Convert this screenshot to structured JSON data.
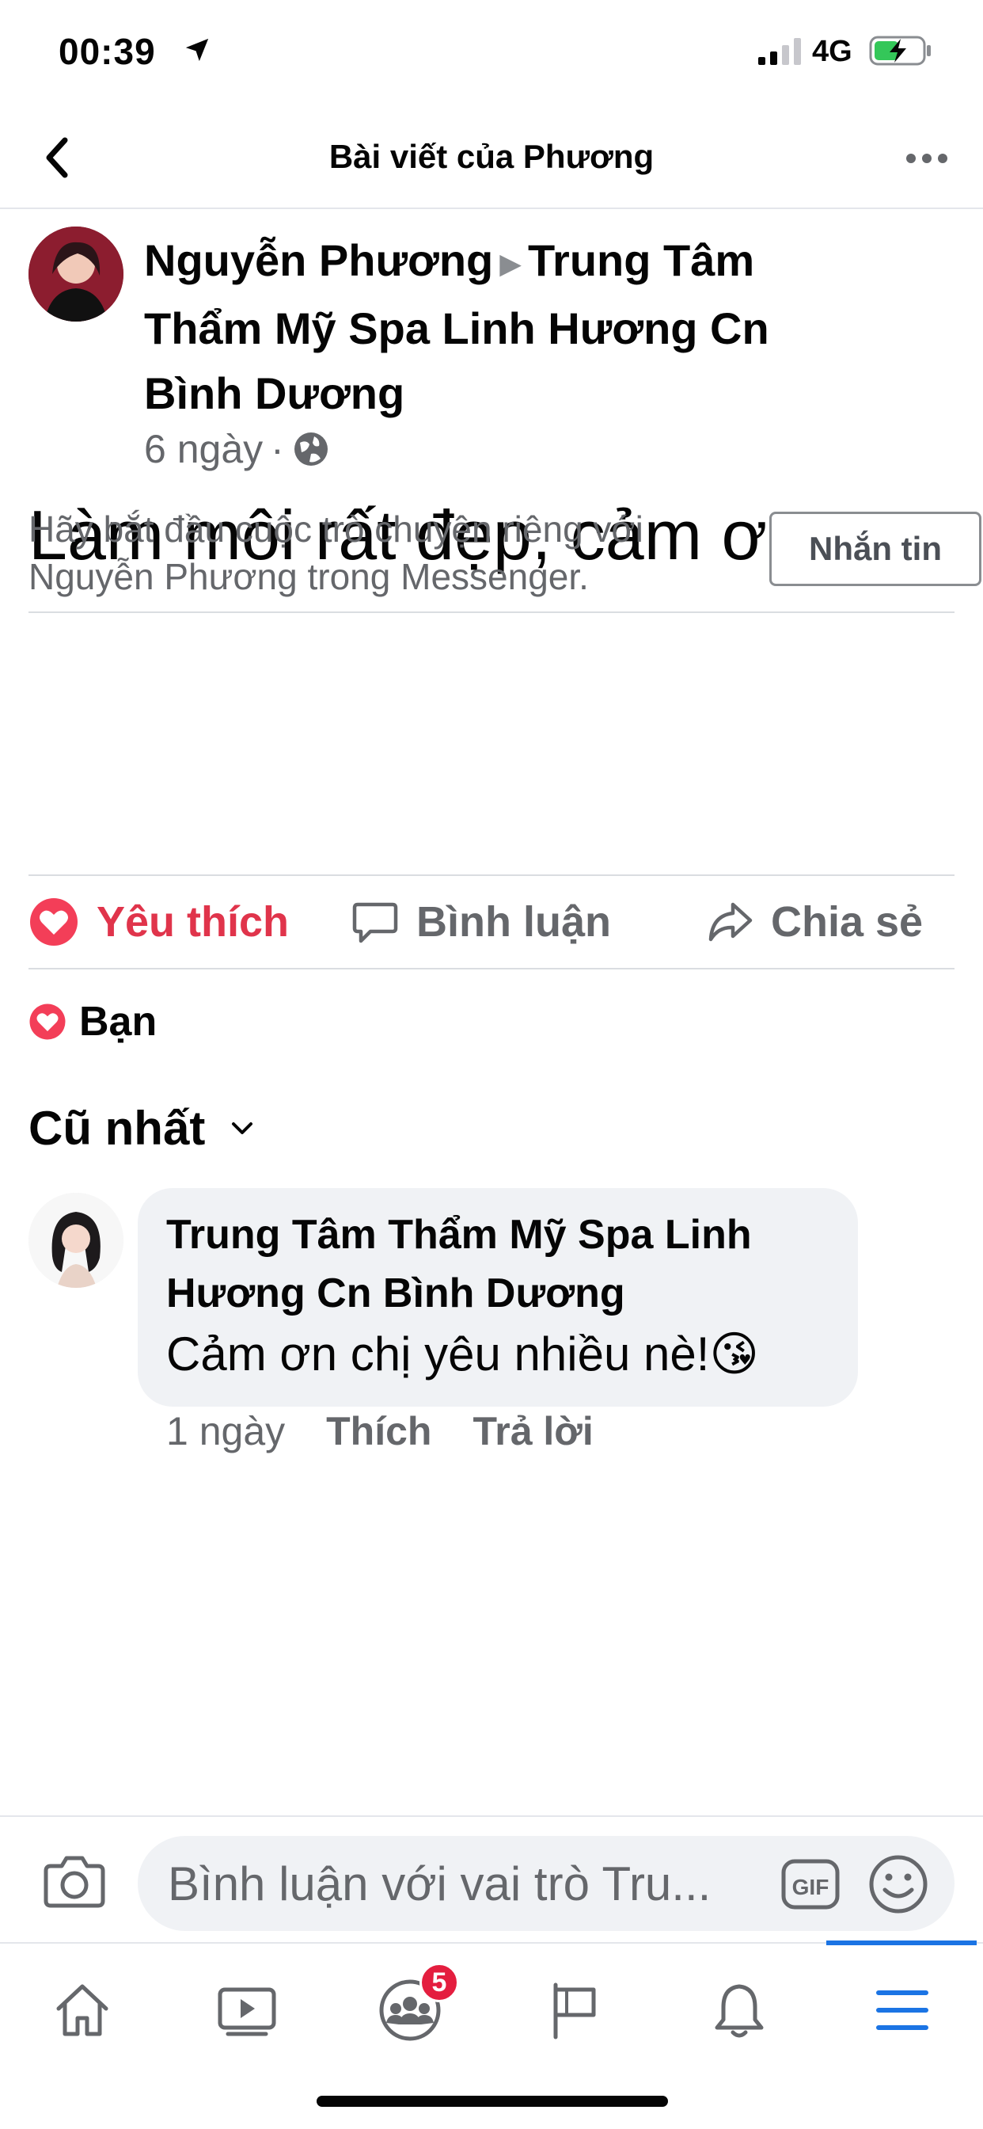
{
  "status_bar": {
    "time": "00:39",
    "network": "4G"
  },
  "header": {
    "title": "Bài viết của Phương"
  },
  "post": {
    "author": "Nguyễn Phương",
    "target": "Trung Tâm Thẩm Mỹ Spa Linh Hương Cn Bình Dương",
    "time": "6 ngày",
    "separator": "·",
    "privacy_icon": "globe-icon",
    "text": "Làm môi rất đẹp,  cảm ơn tmv"
  },
  "messenger_prompt": {
    "text": "Hãy bắt đầu cuộc trò chuyện riêng với Nguyễn Phương trong Messenger.",
    "button_label": "Nhắn tin"
  },
  "actions": {
    "like_label": "Yêu thích",
    "comment_label": "Bình luận",
    "share_label": "Chia sẻ",
    "like_color": "#e0344b"
  },
  "reactions": {
    "summary": "Bạn"
  },
  "comments": {
    "sort_label": "Cũ nhất",
    "items": [
      {
        "author": "Trung Tâm Thẩm Mỹ Spa Linh Hương Cn Bình Dương",
        "text": "Cảm ơn chị yêu nhiều nè!😘",
        "time": "1 ngày",
        "like_label": "Thích",
        "reply_label": "Trả lời"
      }
    ]
  },
  "composer": {
    "placeholder": "Bình luận với vai trò Tru..."
  },
  "tab_bar": {
    "tabs": [
      "home-icon",
      "watch-icon",
      "groups-icon",
      "pages-icon",
      "notifications-icon",
      "menu-icon"
    ],
    "groups_badge": "5",
    "active_color": "#1b74e4"
  }
}
